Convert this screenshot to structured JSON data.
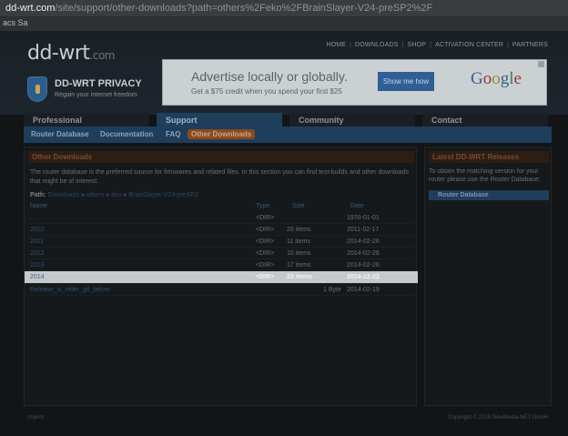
{
  "browser": {
    "url_host": "dd-wrt.com",
    "url_rest": "/site/support/other-downloads?path=others%2Feko%2FBrainSlayer-V24-preSP2%2F",
    "bookmark": "acs Sa"
  },
  "header": {
    "logo": "dd-wrt",
    "logo_suffix": ".com",
    "top_links": [
      "HOME",
      "DOWNLOADS",
      "SHOP",
      "ACTIVATION CENTER",
      "PARTNERS"
    ],
    "privacy_title": "DD-WRT PRIVACY",
    "privacy_sub": "Regain your internet freedom"
  },
  "ad": {
    "headline": "Advertise locally or globally.",
    "sub": "Get a $75 credit when you spend your first $25",
    "button": "Show me how",
    "brand_letters": [
      "G",
      "o",
      "o",
      "g",
      "l",
      "e"
    ]
  },
  "tabs": [
    "Professional",
    "Support",
    "Community",
    "Contact"
  ],
  "subnav": [
    "Router Database",
    "Documentation",
    "FAQ",
    "Other Downloads"
  ],
  "main": {
    "title": "Other Downloads",
    "intro": "The router database is the preferred source for firmwares and related files. In this section you can find test-builds and other downloads that might be of interest.",
    "path_label": "Path:",
    "path_crumbs": [
      "Downloads",
      "others",
      "eko",
      "BrainSlayer-V24-preSP2"
    ],
    "columns": {
      "name": "Name",
      "type": "Type",
      "size": "Size",
      "date": "Date"
    },
    "rows": [
      {
        "name": "..",
        "type": "<DIR>",
        "size": "",
        "date": "1970-01-01"
      },
      {
        "name": "2010",
        "type": "<DIR>",
        "size": "26 items",
        "date": "2011-02-17"
      },
      {
        "name": "2011",
        "type": "<DIR>",
        "size": "11 items",
        "date": "2014-02-26"
      },
      {
        "name": "2012",
        "type": "<DIR>",
        "size": "10 items",
        "date": "2014-02-26"
      },
      {
        "name": "2013",
        "type": "<DIR>",
        "size": "17 items",
        "date": "2014-02-26"
      },
      {
        "name": "2014",
        "type": "<DIR>",
        "size": "23 items",
        "date": "2014-12-22"
      },
      {
        "name": "Release_is_older_git_below",
        "type": "1 Byte",
        "size": "",
        "date": "2014-02-19"
      }
    ]
  },
  "sidebar": {
    "title": "Latest DD-WRT Releases",
    "text": "To obtain the matching version for your router please use the Router Database:",
    "link": "Router Database"
  },
  "footer": {
    "left": "Imprint",
    "right": "Copyright © 2015 NewMedia-NET GmbH"
  }
}
